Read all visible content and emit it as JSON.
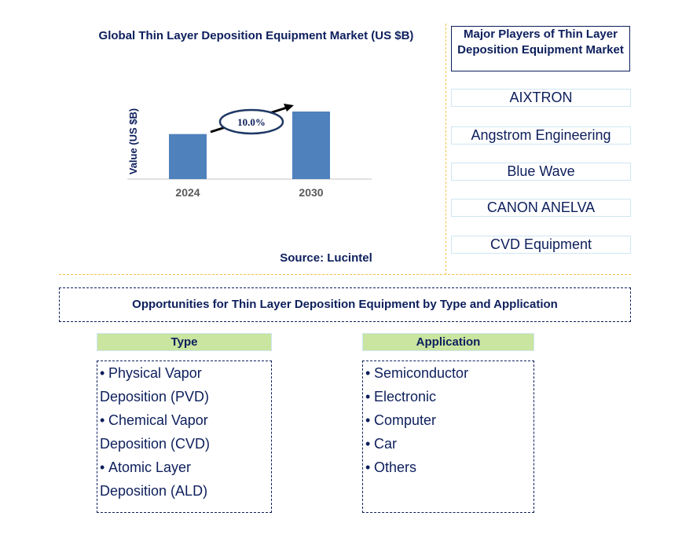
{
  "chart_data": {
    "type": "bar",
    "title": "Global Thin Layer Deposition Equipment Market (US $B)",
    "xlabel": "",
    "ylabel": "Value (US $B)",
    "categories": [
      "2024",
      "2030"
    ],
    "values": [
      1.0,
      1.5
    ],
    "value_note": "Relative bar heights estimated from image; no y-axis ticks shown",
    "ylim": [
      0,
      1.5
    ],
    "grid": false,
    "annotation": {
      "text": "10.0%",
      "meaning": "CAGR 2024-2030",
      "style": "ellipse with upward arrow"
    },
    "bar_color": "#4f81bd",
    "source": "Source: Lucintel"
  },
  "players": {
    "title": "Major Players of Thin Layer Deposition Equipment Market",
    "items": [
      "AIXTRON",
      "Angstrom Engineering",
      "Blue Wave",
      "CANON ANELVA",
      "CVD Equipment"
    ]
  },
  "opportunities": {
    "title": "Opportunities for Thin Layer Deposition Equipment by Type and Application",
    "type": {
      "header": "Type",
      "items": [
        [
          "Physical Vapor",
          "Deposition (PVD)"
        ],
        [
          "Chemical Vapor",
          "Deposition (CVD)"
        ],
        [
          "Atomic Layer",
          "Deposition (ALD)"
        ]
      ]
    },
    "application": {
      "header": "Application",
      "items": [
        "Semiconductor",
        "Electronic",
        "Computer",
        "Car",
        "Others"
      ]
    }
  },
  "colors": {
    "text": "#0d1f5c",
    "bar": "#4f81bd",
    "header_fill": "#c9e5a0",
    "divider": "#f5c242"
  },
  "bullet": "•"
}
